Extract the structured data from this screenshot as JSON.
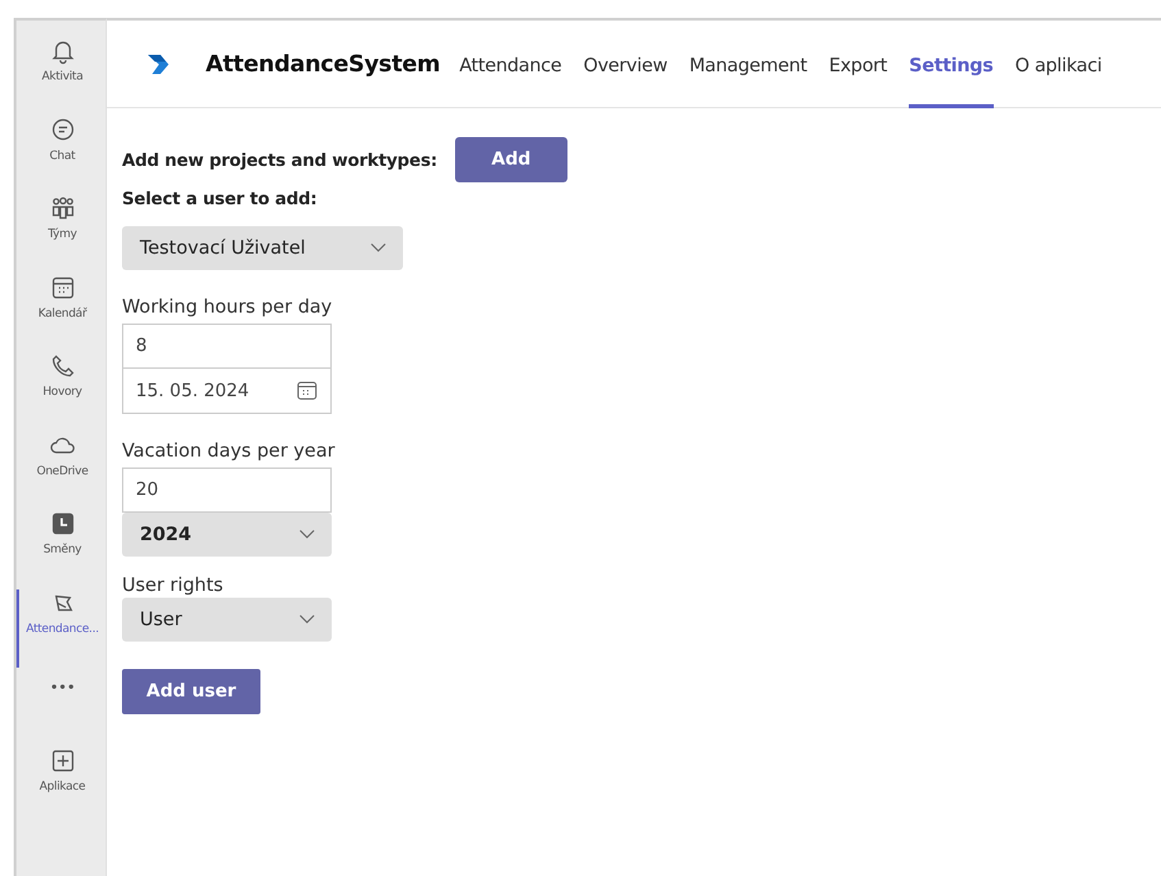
{
  "sidebar": {
    "items": [
      {
        "kind": "bell",
        "label": "Aktivita",
        "selected": false
      },
      {
        "kind": "chat",
        "label": "Chat",
        "selected": false
      },
      {
        "kind": "teams",
        "label": "Týmy",
        "selected": false
      },
      {
        "kind": "calendar",
        "label": "Kalendář",
        "selected": false
      },
      {
        "kind": "phone",
        "label": "Hovory",
        "selected": false
      },
      {
        "kind": "cloud",
        "label": "OneDrive",
        "selected": false
      },
      {
        "kind": "clock",
        "label": "Směny",
        "selected": false
      },
      {
        "kind": "app",
        "label": "Attendance...",
        "selected": true
      },
      {
        "kind": "more",
        "label": "•••",
        "selected": false
      },
      {
        "kind": "plus",
        "label": "Aplikace",
        "selected": false
      }
    ]
  },
  "app": {
    "title": "AttendanceSystem",
    "tabs": [
      {
        "label": "Attendance",
        "selected": false
      },
      {
        "label": "Overview",
        "selected": false
      },
      {
        "label": "Management",
        "selected": false
      },
      {
        "label": "Export",
        "selected": false
      },
      {
        "label": "Settings",
        "selected": true
      },
      {
        "label": "O aplikaci",
        "selected": false
      }
    ]
  },
  "settings": {
    "add_projects_label": "Add new projects and worktypes:",
    "add_button": "Add",
    "select_user_label": "Select a user to add:",
    "user_select": "Testovací Uživatel",
    "working_hours_label": "Working hours per day",
    "working_hours": "8",
    "date": "15. 05. 2024",
    "vacation_label": "Vacation days per year",
    "vacation_days": "20",
    "year_select": "2024",
    "rights_label": "User rights",
    "rights_select": "User",
    "add_user_button": "Add user"
  }
}
